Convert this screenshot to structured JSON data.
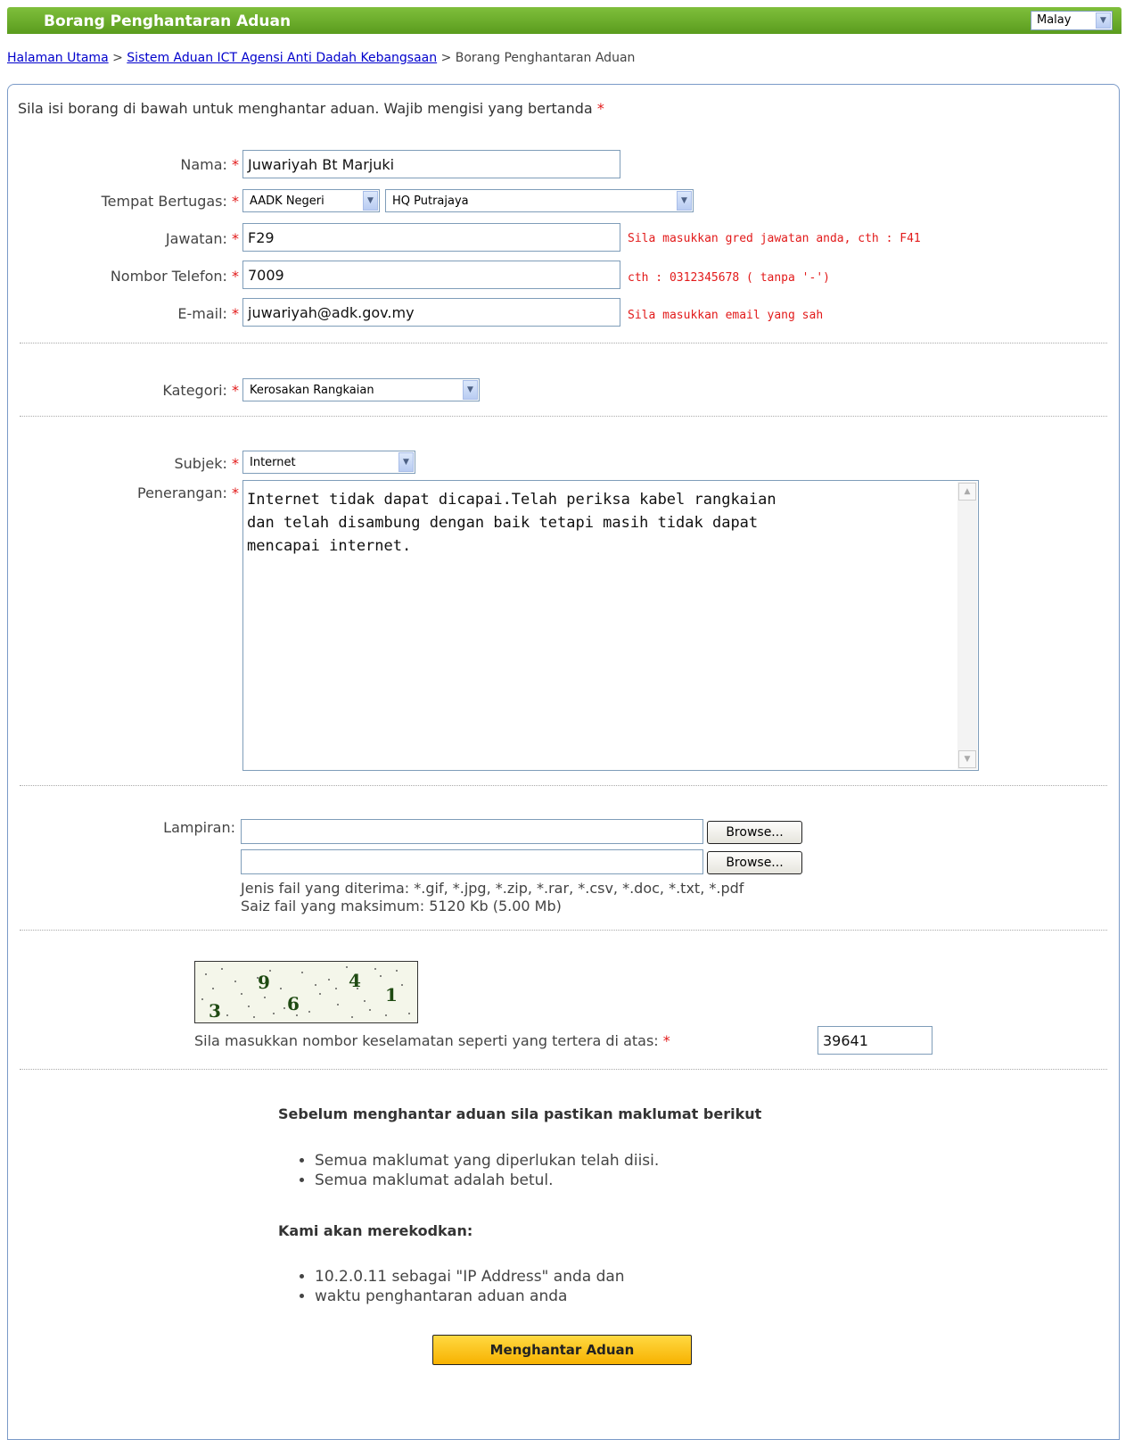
{
  "header": {
    "title": "Borang Penghantaran Aduan",
    "language": "Malay"
  },
  "breadcrumb": {
    "home": "Halaman Utama",
    "sep1": ">",
    "system": "Sistem Aduan ICT Agensi Anti Dadah Kebangsaan",
    "sep2": ">",
    "current": "Borang Penghantaran Aduan"
  },
  "form": {
    "intro": "Sila isi borang di bawah untuk menghantar aduan. Wajib mengisi yang bertanda",
    "required_mark": "*",
    "nama": {
      "label": "Nama:",
      "value": "Juwariyah Bt Marjuki"
    },
    "tempat": {
      "label": "Tempat Bertugas:",
      "select1": "AADK Negeri",
      "select2": "HQ Putrajaya"
    },
    "jawatan": {
      "label": "Jawatan:",
      "value": "F29",
      "hint": "Sila masukkan gred jawatan anda, cth : F41"
    },
    "telefon": {
      "label": "Nombor Telefon:",
      "value": "7009",
      "hint": "cth : 0312345678 ( tanpa '-')"
    },
    "email": {
      "label": "E-mail:",
      "value": "juwariyah@adk.gov.my",
      "hint": "Sila masukkan email yang sah"
    },
    "kategori": {
      "label": "Kategori:",
      "value": "Kerosakan Rangkaian"
    },
    "subjek": {
      "label": "Subjek:",
      "value": "Internet"
    },
    "penerangan": {
      "label": "Penerangan:",
      "value": "Internet tidak dapat dicapai.Telah periksa kabel rangkaian\ndan telah disambung dengan baik tetapi masih tidak dapat\nmencapai internet."
    },
    "lampiran": {
      "label": "Lampiran:",
      "browse": "Browse...",
      "types": "Jenis fail yang diterima: *.gif, *.jpg, *.zip, *.rar, *.csv, *.doc, *.txt, *.pdf",
      "max": "Saiz fail yang maksimum: 5120 Kb (5.00 Mb)"
    },
    "captcha": {
      "digits": [
        "3",
        "9",
        "6",
        "4",
        "1"
      ],
      "label": "Sila masukkan nombor keselamatan seperti yang tertera di atas:",
      "value": "39641"
    }
  },
  "notice": {
    "heading1": "Sebelum menghantar aduan sila pastikan maklumat berikut",
    "items1": [
      "Semua maklumat yang diperlukan telah diisi.",
      "Semua maklumat adalah betul."
    ],
    "heading2": "Kami akan merekodkan:",
    "items2": [
      "10.2.0.11 sebagai \"IP Address\" anda dan",
      "waktu penghantaran aduan anda"
    ]
  },
  "submit_label": "Menghantar Aduan",
  "colors": {
    "header_green": "#6aad2a",
    "required_red": "#e21a1a",
    "submit_yellow": "#fcc51b"
  }
}
